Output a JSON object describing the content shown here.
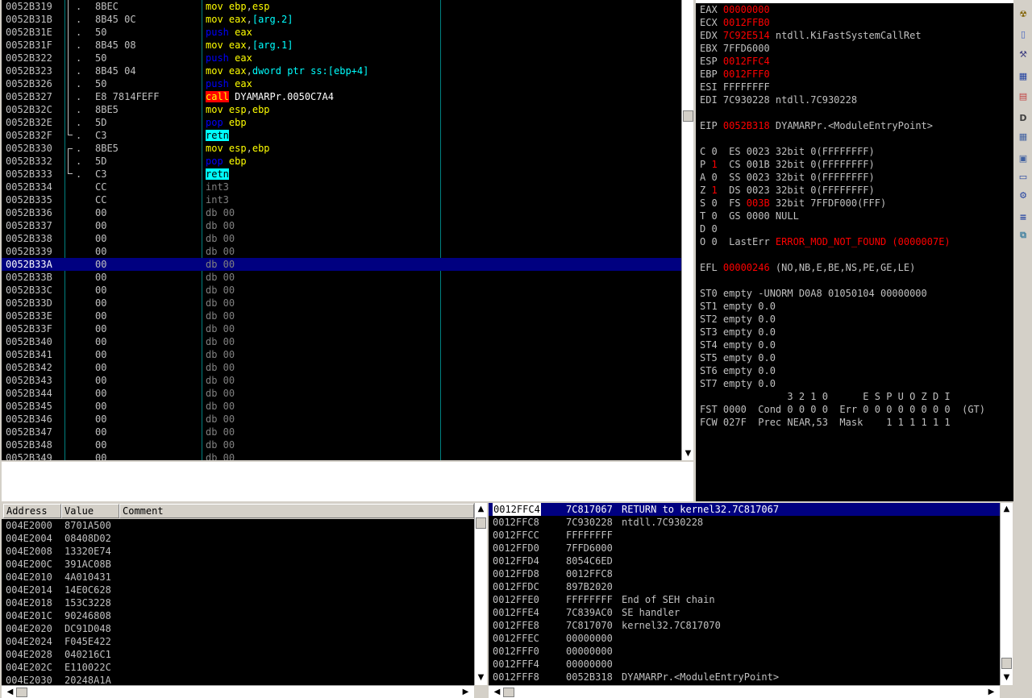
{
  "colors": {
    "bg": "#000000",
    "text_default": "#c0c0c0",
    "mov": "#ffff00",
    "push_pop": "#0000ff",
    "operand": "#00ffff",
    "call_bg": "#ff0000",
    "call_fg": "#ffff00",
    "retn_bg": "#00ffff",
    "retn_fg": "#000000",
    "db_fg": "#808080",
    "changed_reg": "#ff0000",
    "selection": "#000080"
  },
  "disasm": {
    "selected_index": 20,
    "rows": [
      {
        "addr": "0052B319",
        "mark": ".",
        "hex": "8BEC",
        "asm": [
          [
            "mov",
            "#ffff00"
          ],
          [
            " ",
            "#c0c0c0"
          ],
          [
            "ebp",
            "#ffff00"
          ],
          [
            ",",
            "#c0c0c0"
          ],
          [
            "esp",
            "#ffff00"
          ]
        ]
      },
      {
        "addr": "0052B31B",
        "mark": ".",
        "hex": "8B45 0C",
        "asm": [
          [
            "mov",
            "#ffff00"
          ],
          [
            " ",
            "#c0c0c0"
          ],
          [
            "eax",
            "#ffff00"
          ],
          [
            ",",
            "#c0c0c0"
          ],
          [
            "[arg.2]",
            "#00ffff"
          ]
        ]
      },
      {
        "addr": "0052B31E",
        "mark": ".",
        "hex": "50",
        "asm": [
          [
            "push",
            "#0000ff"
          ],
          [
            " ",
            "#c0c0c0"
          ],
          [
            "eax",
            "#ffff00"
          ]
        ]
      },
      {
        "addr": "0052B31F",
        "mark": ".",
        "hex": "8B45 08",
        "asm": [
          [
            "mov",
            "#ffff00"
          ],
          [
            " ",
            "#c0c0c0"
          ],
          [
            "eax",
            "#ffff00"
          ],
          [
            ",",
            "#c0c0c0"
          ],
          [
            "[arg.1]",
            "#00ffff"
          ]
        ]
      },
      {
        "addr": "0052B322",
        "mark": ".",
        "hex": "50",
        "asm": [
          [
            "push",
            "#0000ff"
          ],
          [
            " ",
            "#c0c0c0"
          ],
          [
            "eax",
            "#ffff00"
          ]
        ]
      },
      {
        "addr": "0052B323",
        "mark": ".",
        "hex": "8B45 04",
        "asm": [
          [
            "mov",
            "#ffff00"
          ],
          [
            " ",
            "#c0c0c0"
          ],
          [
            "eax",
            "#ffff00"
          ],
          [
            ",",
            "#c0c0c0"
          ],
          [
            "dword ptr ss:[ebp+4]",
            "#00ffff"
          ]
        ]
      },
      {
        "addr": "0052B326",
        "mark": ".",
        "hex": "50",
        "asm": [
          [
            "push",
            "#0000ff"
          ],
          [
            " ",
            "#c0c0c0"
          ],
          [
            "eax",
            "#ffff00"
          ]
        ]
      },
      {
        "addr": "0052B327",
        "mark": ".",
        "hex": "E8 7814FEFF",
        "asm": [
          [
            "call",
            "#ffff00",
            "#ff0000"
          ],
          [
            " DYAMARPr.0050C7A4",
            "#ffffff"
          ]
        ]
      },
      {
        "addr": "0052B32C",
        "mark": ".",
        "hex": "8BE5",
        "asm": [
          [
            "mov",
            "#ffff00"
          ],
          [
            " ",
            "#c0c0c0"
          ],
          [
            "esp",
            "#ffff00"
          ],
          [
            ",",
            "#c0c0c0"
          ],
          [
            "ebp",
            "#ffff00"
          ]
        ]
      },
      {
        "addr": "0052B32E",
        "mark": ".",
        "hex": "5D",
        "asm": [
          [
            "pop",
            "#0000ff"
          ],
          [
            " ",
            "#c0c0c0"
          ],
          [
            "ebp",
            "#ffff00"
          ]
        ]
      },
      {
        "addr": "0052B32F",
        "mark": "\\.",
        "hex": "C3",
        "asm": [
          [
            "retn",
            "#000000",
            "#00ffff"
          ]
        ]
      },
      {
        "addr": "0052B330",
        "mark": "r.",
        "hex": "8BE5",
        "asm": [
          [
            "mov",
            "#ffff00"
          ],
          [
            " ",
            "#c0c0c0"
          ],
          [
            "esp",
            "#ffff00"
          ],
          [
            ",",
            "#c0c0c0"
          ],
          [
            "ebp",
            "#ffff00"
          ]
        ]
      },
      {
        "addr": "0052B332",
        "mark": ".",
        "hex": "5D",
        "asm": [
          [
            "pop",
            "#0000ff"
          ],
          [
            " ",
            "#c0c0c0"
          ],
          [
            "ebp",
            "#ffff00"
          ]
        ]
      },
      {
        "addr": "0052B333",
        "mark": "\\.",
        "hex": "C3",
        "asm": [
          [
            "retn",
            "#000000",
            "#00ffff"
          ]
        ]
      },
      {
        "addr": "0052B334",
        "mark": "",
        "hex": "CC",
        "asm": [
          [
            "int3",
            "#808080"
          ]
        ]
      },
      {
        "addr": "0052B335",
        "mark": "",
        "hex": "CC",
        "asm": [
          [
            "int3",
            "#808080"
          ]
        ]
      },
      {
        "addr": "0052B336",
        "mark": "",
        "hex": "00",
        "asm": [
          [
            "db 00",
            "#808080"
          ]
        ]
      },
      {
        "addr": "0052B337",
        "mark": "",
        "hex": "00",
        "asm": [
          [
            "db 00",
            "#808080"
          ]
        ]
      },
      {
        "addr": "0052B338",
        "mark": "",
        "hex": "00",
        "asm": [
          [
            "db 00",
            "#808080"
          ]
        ]
      },
      {
        "addr": "0052B339",
        "mark": "",
        "hex": "00",
        "asm": [
          [
            "db 00",
            "#808080"
          ]
        ]
      },
      {
        "addr": "0052B33A",
        "mark": "",
        "hex": "00",
        "asm": [
          [
            "db 00",
            "#808080"
          ]
        ]
      },
      {
        "addr": "0052B33B",
        "mark": "",
        "hex": "00",
        "asm": [
          [
            "db 00",
            "#808080"
          ]
        ]
      },
      {
        "addr": "0052B33C",
        "mark": "",
        "hex": "00",
        "asm": [
          [
            "db 00",
            "#808080"
          ]
        ]
      },
      {
        "addr": "0052B33D",
        "mark": "",
        "hex": "00",
        "asm": [
          [
            "db 00",
            "#808080"
          ]
        ]
      },
      {
        "addr": "0052B33E",
        "mark": "",
        "hex": "00",
        "asm": [
          [
            "db 00",
            "#808080"
          ]
        ]
      },
      {
        "addr": "0052B33F",
        "mark": "",
        "hex": "00",
        "asm": [
          [
            "db 00",
            "#808080"
          ]
        ]
      },
      {
        "addr": "0052B340",
        "mark": "",
        "hex": "00",
        "asm": [
          [
            "db 00",
            "#808080"
          ]
        ]
      },
      {
        "addr": "0052B341",
        "mark": "",
        "hex": "00",
        "asm": [
          [
            "db 00",
            "#808080"
          ]
        ]
      },
      {
        "addr": "0052B342",
        "mark": "",
        "hex": "00",
        "asm": [
          [
            "db 00",
            "#808080"
          ]
        ]
      },
      {
        "addr": "0052B343",
        "mark": "",
        "hex": "00",
        "asm": [
          [
            "db 00",
            "#808080"
          ]
        ]
      },
      {
        "addr": "0052B344",
        "mark": "",
        "hex": "00",
        "asm": [
          [
            "db 00",
            "#808080"
          ]
        ]
      },
      {
        "addr": "0052B345",
        "mark": "",
        "hex": "00",
        "asm": [
          [
            "db 00",
            "#808080"
          ]
        ]
      },
      {
        "addr": "0052B346",
        "mark": "",
        "hex": "00",
        "asm": [
          [
            "db 00",
            "#808080"
          ]
        ]
      },
      {
        "addr": "0052B347",
        "mark": "",
        "hex": "00",
        "asm": [
          [
            "db 00",
            "#808080"
          ]
        ]
      },
      {
        "addr": "0052B348",
        "mark": "",
        "hex": "00",
        "asm": [
          [
            "db 00",
            "#808080"
          ]
        ]
      },
      {
        "addr": "0052B349",
        "mark": "",
        "hex": "00",
        "asm": [
          [
            "db 00",
            "#808080"
          ]
        ]
      }
    ]
  },
  "registers": {
    "rows": [
      [
        [
          "EAX ",
          "#c0c0c0"
        ],
        [
          "00000000",
          "#ff0000"
        ]
      ],
      [
        [
          "ECX ",
          "#c0c0c0"
        ],
        [
          "0012FFB0",
          "#ff0000"
        ]
      ],
      [
        [
          "EDX ",
          "#c0c0c0"
        ],
        [
          "7C92E514",
          "#ff0000"
        ],
        [
          " ntdll.KiFastSystemCallRet",
          "#c0c0c0"
        ]
      ],
      [
        [
          "EBX 7FFD6000",
          "#c0c0c0"
        ]
      ],
      [
        [
          "ESP ",
          "#c0c0c0"
        ],
        [
          "0012FFC4",
          "#ff0000"
        ]
      ],
      [
        [
          "EBP ",
          "#c0c0c0"
        ],
        [
          "0012FFF0",
          "#ff0000"
        ]
      ],
      [
        [
          "ESI FFFFFFFF",
          "#c0c0c0"
        ]
      ],
      [
        [
          "EDI 7C930228 ntdll.7C930228",
          "#c0c0c0"
        ]
      ],
      [],
      [
        [
          "EIP ",
          "#c0c0c0"
        ],
        [
          "0052B318",
          "#ff0000"
        ],
        [
          " DYAMARPr.<ModuleEntryPoint>",
          "#c0c0c0"
        ]
      ],
      [],
      [
        [
          "C 0  ES 0023 32bit 0(FFFFFFFF)",
          "#c0c0c0"
        ]
      ],
      [
        [
          "P ",
          "#c0c0c0"
        ],
        [
          "1",
          "#ff0000"
        ],
        [
          "  CS 001B 32bit 0(FFFFFFFF)",
          "#c0c0c0"
        ]
      ],
      [
        [
          "A 0  SS 0023 32bit 0(FFFFFFFF)",
          "#c0c0c0"
        ]
      ],
      [
        [
          "Z ",
          "#c0c0c0"
        ],
        [
          "1",
          "#ff0000"
        ],
        [
          "  DS 0023 32bit 0(FFFFFFFF)",
          "#c0c0c0"
        ]
      ],
      [
        [
          "S 0  FS ",
          "#c0c0c0"
        ],
        [
          "003B",
          "#ff0000"
        ],
        [
          " 32bit 7FFDF000(FFF)",
          "#c0c0c0"
        ]
      ],
      [
        [
          "T 0  GS 0000 NULL",
          "#c0c0c0"
        ]
      ],
      [
        [
          "D 0",
          "#c0c0c0"
        ]
      ],
      [
        [
          "O 0  LastErr ",
          "#c0c0c0"
        ],
        [
          "ERROR_MOD_NOT_FOUND (0000007E)",
          "#ff0000"
        ]
      ],
      [],
      [
        [
          "EFL ",
          "#c0c0c0"
        ],
        [
          "00000246",
          "#ff0000"
        ],
        [
          " (NO,NB,E,BE,NS,PE,GE,LE)",
          "#c0c0c0"
        ]
      ],
      [],
      [
        [
          "ST0 empty -UNORM D0A8 01050104 00000000",
          "#c0c0c0"
        ]
      ],
      [
        [
          "ST1 empty 0.0",
          "#c0c0c0"
        ]
      ],
      [
        [
          "ST2 empty 0.0",
          "#c0c0c0"
        ]
      ],
      [
        [
          "ST3 empty 0.0",
          "#c0c0c0"
        ]
      ],
      [
        [
          "ST4 empty 0.0",
          "#c0c0c0"
        ]
      ],
      [
        [
          "ST5 empty 0.0",
          "#c0c0c0"
        ]
      ],
      [
        [
          "ST6 empty 0.0",
          "#c0c0c0"
        ]
      ],
      [
        [
          "ST7 empty 0.0",
          "#c0c0c0"
        ]
      ],
      [
        [
          "               3 2 1 0      E S P U O Z D I",
          "#c0c0c0"
        ]
      ],
      [
        [
          "FST 0000  Cond 0 0 0 0  Err 0 0 0 0 0 0 0 0  (GT)",
          "#c0c0c0"
        ]
      ],
      [
        [
          "FCW 027F  Prec NEAR,53  Mask    1 1 1 1 1 1",
          "#c0c0c0"
        ]
      ]
    ]
  },
  "dump": {
    "headers": [
      "Address",
      "Value",
      "Comment"
    ],
    "rows": [
      [
        "004E2000",
        "8701A500"
      ],
      [
        "004E2004",
        "08408D02"
      ],
      [
        "004E2008",
        "13320E74"
      ],
      [
        "004E200C",
        "391AC08B"
      ],
      [
        "004E2010",
        "4A010431"
      ],
      [
        "004E2014",
        "14E0C628"
      ],
      [
        "004E2018",
        "153C3228"
      ],
      [
        "004E201C",
        "90246808"
      ],
      [
        "004E2020",
        "DC91D048"
      ],
      [
        "004E2024",
        "F045E422"
      ],
      [
        "004E2028",
        "040216C1"
      ],
      [
        "004E202C",
        "E110022C"
      ],
      [
        "004E2030",
        "20248A1A"
      ]
    ]
  },
  "stack": {
    "selected_index": 0,
    "rows": [
      [
        "0012FFC4",
        "7C817067",
        "RETURN to kernel32.7C817067"
      ],
      [
        "0012FFC8",
        "7C930228",
        "ntdll.7C930228"
      ],
      [
        "0012FFCC",
        "FFFFFFFF",
        ""
      ],
      [
        "0012FFD0",
        "7FFD6000",
        ""
      ],
      [
        "0012FFD4",
        "8054C6ED",
        ""
      ],
      [
        "0012FFD8",
        "0012FFC8",
        ""
      ],
      [
        "0012FFDC",
        "897B2020",
        ""
      ],
      [
        "0012FFE0",
        "FFFFFFFF",
        "End of SEH chain"
      ],
      [
        "0012FFE4",
        "7C839AC0",
        "SE handler"
      ],
      [
        "0012FFE8",
        "7C817070",
        "kernel32.7C817070"
      ],
      [
        "0012FFEC",
        "00000000",
        ""
      ],
      [
        "0012FFF0",
        "00000000",
        ""
      ],
      [
        "0012FFF4",
        "00000000",
        ""
      ],
      [
        "0012FFF8",
        "0052B318",
        "DYAMARPr.<ModuleEntryPoint>"
      ]
    ]
  },
  "toolbar": {
    "buttons": [
      {
        "icon": "radiation-icon",
        "glyph": "☢",
        "color": "#806000"
      },
      {
        "icon": "page-icon",
        "glyph": "▯",
        "color": "#4060c0"
      },
      {
        "icon": "wrench-icon",
        "glyph": "⚒",
        "color": "#404080"
      },
      {
        "icon": "calc-icon",
        "glyph": "▦",
        "color": "#2040a0"
      },
      {
        "icon": "grid-icon",
        "glyph": "▤",
        "color": "#c04040"
      },
      {
        "icon": "d-icon",
        "glyph": "D",
        "color": "#404040"
      },
      {
        "icon": "table-icon",
        "glyph": "▦",
        "color": "#4060a0"
      },
      {
        "icon": "fpu-calc-icon",
        "glyph": "▣",
        "color": "#4060a0"
      },
      {
        "icon": "window-icon",
        "glyph": "▭",
        "color": "#2040a0"
      },
      {
        "icon": "gear-icon",
        "glyph": "⚙",
        "color": "#2040a0"
      },
      {
        "icon": "list-icon",
        "glyph": "≡",
        "color": "#2040a0"
      },
      {
        "icon": "network-icon",
        "glyph": "⧉",
        "color": "#4080a0"
      }
    ]
  }
}
